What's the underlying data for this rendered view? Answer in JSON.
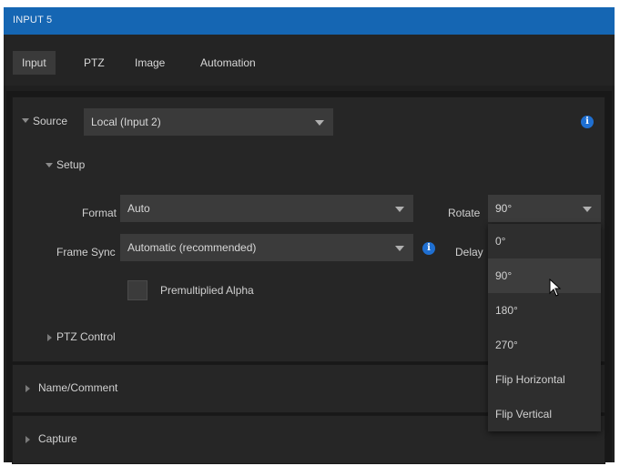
{
  "window": {
    "title": "INPUT 5"
  },
  "tabs": [
    {
      "label": "Input",
      "active": true
    },
    {
      "label": "PTZ",
      "active": false
    },
    {
      "label": "Image",
      "active": false
    },
    {
      "label": "Automation",
      "active": false
    }
  ],
  "source": {
    "label": "Source",
    "value": "Local (Input 2)"
  },
  "setup": {
    "label": "Setup",
    "format": {
      "label": "Format",
      "value": "Auto"
    },
    "frame_sync": {
      "label": "Frame Sync",
      "value": "Automatic (recommended)"
    },
    "premultiplied_alpha": {
      "label": "Premultiplied Alpha",
      "checked": false
    },
    "rotate": {
      "label": "Rotate",
      "value": "90°"
    },
    "delay": {
      "label": "Delay"
    }
  },
  "ptz_control": {
    "label": "PTZ Control"
  },
  "name_comment": {
    "label": "Name/Comment"
  },
  "capture": {
    "label": "Capture"
  },
  "rotate_options": [
    "0°",
    "90°",
    "180°",
    "270°",
    "Flip Horizontal",
    "Flip Vertical"
  ],
  "hovered_option": "90°",
  "info_glyph": "i",
  "colors": {
    "accent": "#1566b3",
    "info": "#1f6fd1",
    "background": "#1f1f1f"
  }
}
